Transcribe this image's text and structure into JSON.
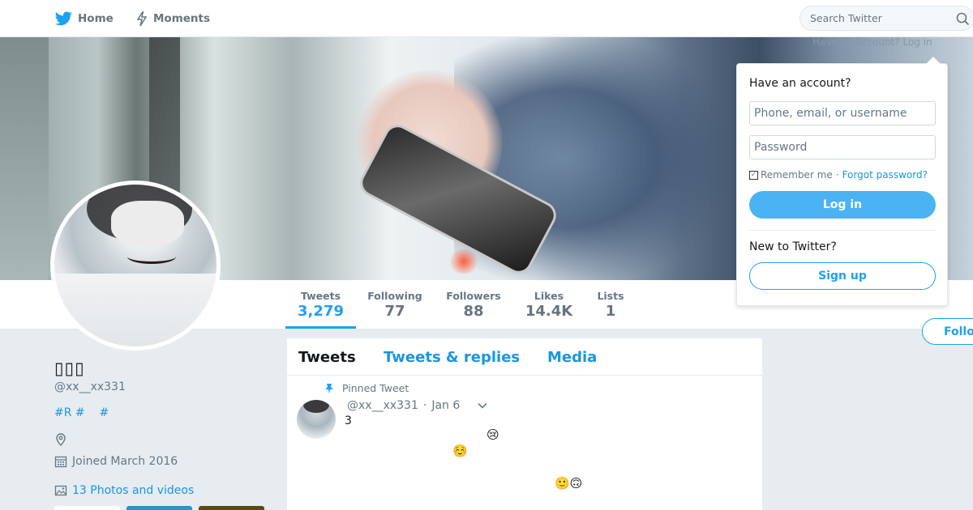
{
  "colors": {
    "accent": "#1da1f2",
    "link": "#1b95e0",
    "muted": "#657786",
    "background": "#e6ecf0"
  },
  "nav": {
    "home_label": "Home",
    "moments_label": "Moments",
    "search_placeholder": "Search Twitter",
    "icons": {
      "logo": "twitter-bird-icon",
      "moments": "lightning-icon",
      "search": "search-icon"
    }
  },
  "login_hint": "Have an account? Log in",
  "login": {
    "heading": "Have an account?",
    "username_placeholder": "Phone, email, or username",
    "password_placeholder": "Password",
    "remember_label": "Remember me",
    "separator": "·",
    "forgot_label": "Forgot password?",
    "login_button": "Log in",
    "new_heading": "New to Twitter?",
    "signup_button": "Sign up"
  },
  "stats": [
    {
      "label": "Tweets",
      "value": "3,279",
      "active": true
    },
    {
      "label": "Following",
      "value": "77"
    },
    {
      "label": "Followers",
      "value": "88"
    },
    {
      "label": "Likes",
      "value": "14.4K"
    },
    {
      "label": "Lists",
      "value": "1"
    }
  ],
  "follow_button": "Follow",
  "profile": {
    "name": "▯▯▯",
    "handle": "@xx__xx331",
    "bio": "#R #    #",
    "joined": "Joined March 2016",
    "photos_link": "13 Photos and videos",
    "icons": {
      "location": "location-pin-icon",
      "joined": "calendar-icon",
      "photos": "image-icon"
    }
  },
  "timeline": {
    "tabs": [
      "Tweets",
      "Tweets & replies",
      "Media"
    ],
    "active_tab": "Tweets",
    "pinned_label": "Pinned Tweet",
    "tweet": {
      "handle": "@xx__xx331",
      "separator": "·",
      "date": "Jan 6",
      "text": "3",
      "emojis": [
        "😢",
        "☺️",
        "🙂🙃"
      ]
    }
  }
}
